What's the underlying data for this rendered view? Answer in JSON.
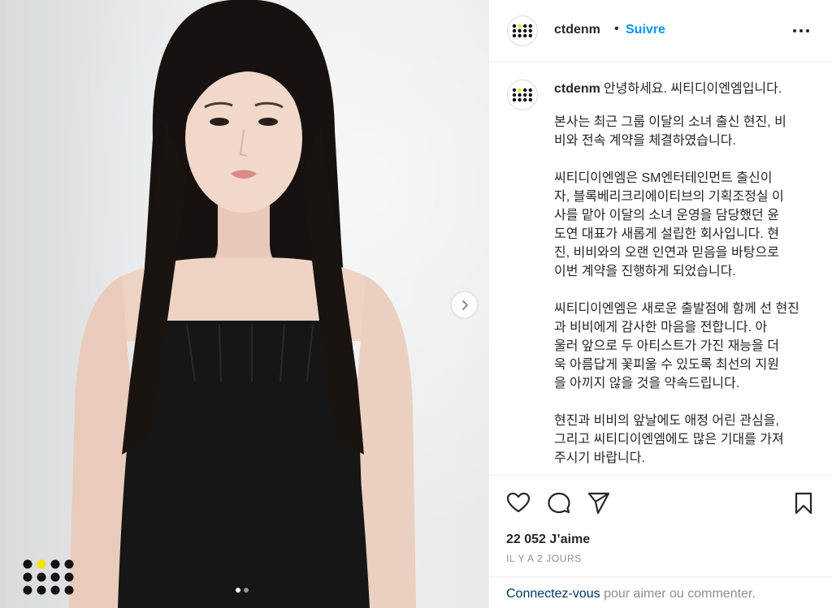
{
  "post": {
    "username": "ctdenm",
    "separator": "•",
    "follow_label": "Suivre",
    "more_icon": "more-horizontal-icon"
  },
  "caption": {
    "username": "ctdenm",
    "first_line": "안녕하세요. 씨티디이엔엠입니다.",
    "paragraphs": [
      "본사는 최근 그룹 이달의 소녀 출신 현진, 비\n비와 전속 계약을 체결하였습니다.",
      "씨티디이엔엠은 SM엔터테인먼트 출신이\n자, 블록베리크리에이티브의 기획조정실 이\n사를 맡아 이달의 소녀 운영을 담당했던 윤\n도연 대표가 새롭게 설립한 회사입니다. 현\n진, 비비와의 오랜 인연과 믿음을 바탕으로\n이번 계약을 진행하게 되었습니다.",
      "씨티디이엔엠은 새로운 출발점에 함께 선 현진\n과 비비에게 감사한 마음을 전합니다. 아\n울러 앞으로 두 아티스트가 가진 재능을 더\n욱 아름답게 꽃피울 수 있도록 최선의 지원\n을 아끼지 않을 것을 약속드립니다.",
      "현진과 비비의 앞날에도 애정 어린 관심을,\n그리고 씨티디이엔엠에도 많은 기대를 가져\n주시기 바랍니다."
    ]
  },
  "actions": {
    "like_icon": "heart-icon",
    "comment_icon": "comment-icon",
    "share_icon": "send-icon",
    "save_icon": "bookmark-icon"
  },
  "stats": {
    "likes": "22 052 J’aime",
    "time_ago": "IL Y A 2 JOURS"
  },
  "login_prompt": {
    "link_text": "Connectez-vous",
    "rest_text": " pour aimer ou commenter."
  },
  "carousel": {
    "slide_count": 2,
    "active_index": 0
  },
  "colors": {
    "follow_blue": "#0095f6",
    "link_navy": "#00376b",
    "logo_yellow": "#f4e300"
  }
}
